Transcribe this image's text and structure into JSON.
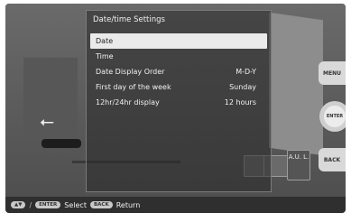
{
  "menu": {
    "title": "Date/time Settings",
    "items": [
      {
        "label": "Date",
        "value": ""
      },
      {
        "label": "Time",
        "value": ""
      },
      {
        "label": "Date Display Order",
        "value": "M-D-Y"
      },
      {
        "label": "First day of the week",
        "value": "Sunday"
      },
      {
        "label": "12hr/24hr display",
        "value": "12 hours"
      }
    ],
    "selected_index": 0
  },
  "side_buttons": {
    "menu": "MENU",
    "enter": "ENTER",
    "back": "BACK"
  },
  "footer": {
    "nav_icon": "▲▼",
    "enter_key": "ENTER",
    "select_label": "Select",
    "back_key": "BACK",
    "return_label": "Return"
  },
  "background": {
    "usb_icon": "usb-icon",
    "tool_label": "A.U. L."
  }
}
